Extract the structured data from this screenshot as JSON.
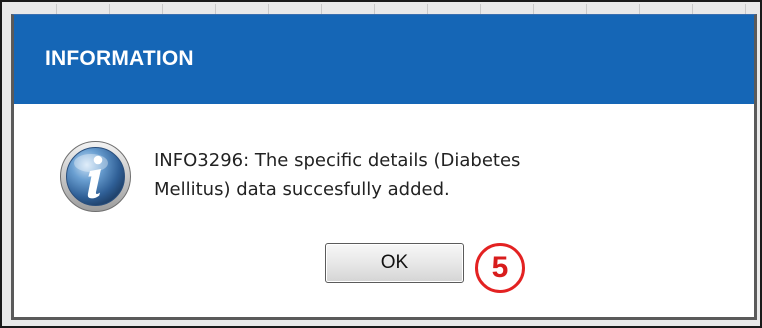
{
  "dialog": {
    "title": "INFORMATION",
    "icon": "info-icon",
    "message_lines": [
      "INFO3296: The specific details (Diabetes",
      "Mellitus) data succesfully added."
    ],
    "ok_label": "OK"
  },
  "annotation": {
    "step_number": "5",
    "color": "#e32222"
  },
  "colors": {
    "titlebar": "#1566b6",
    "title_text": "#ffffff"
  }
}
